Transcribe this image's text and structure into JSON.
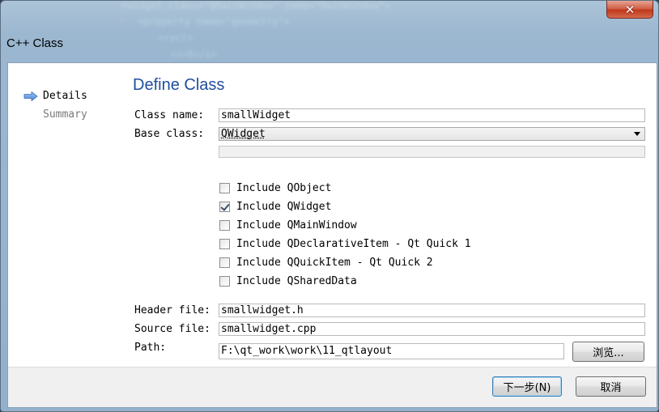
{
  "window": {
    "title": "C++ Class",
    "close_glyph": "✕"
  },
  "nav": {
    "steps": [
      {
        "label": "Details",
        "active": true,
        "icon": "arrow-right-icon"
      },
      {
        "label": "Summary",
        "active": false
      }
    ]
  },
  "page": {
    "title": "Define Class"
  },
  "form": {
    "class_name": {
      "label": "Class name:",
      "value": "smallWidget"
    },
    "base_class": {
      "label": "Base class:",
      "value": "QWidget"
    },
    "base_class_custom": {
      "value": ""
    },
    "includes": [
      {
        "label": "Include QObject",
        "checked": false
      },
      {
        "label": "Include QWidget",
        "checked": true
      },
      {
        "label": "Include QMainWindow",
        "checked": false
      },
      {
        "label": "Include QDeclarativeItem - Qt Quick 1",
        "checked": false
      },
      {
        "label": "Include QQuickItem - Qt Quick 2",
        "checked": false
      },
      {
        "label": "Include QSharedData",
        "checked": false
      }
    ],
    "header_file": {
      "label": "Header file:",
      "value": "smallwidget.h"
    },
    "source_file": {
      "label": "Source file:",
      "value": "smallwidget.cpp"
    },
    "path": {
      "label": "Path:",
      "value": "F:\\qt_work\\work\\11_qtlayout",
      "browse_label": "浏览..."
    }
  },
  "buttons": {
    "next_label": "下一步(N)",
    "cancel_label": "取消"
  },
  "colors": {
    "title_blue": "#1f4e9e",
    "close_red": "#c0391b"
  }
}
